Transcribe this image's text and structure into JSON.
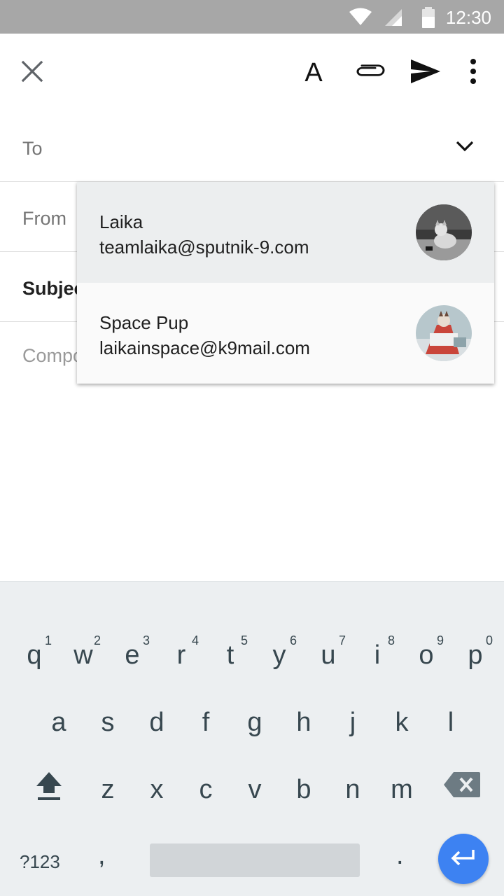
{
  "status_bar": {
    "time": "12:30",
    "icons": [
      "wifi-icon",
      "cellular-signal-icon",
      "battery-icon"
    ],
    "background_color": "#a7a7a7"
  },
  "toolbar": {
    "close_icon": "close-icon",
    "format_label": "A",
    "attach_icon": "paperclip-icon",
    "send_icon": "send-icon",
    "more_icon": "more-vert-icon"
  },
  "fields": {
    "to_label": "To",
    "from_label": "From",
    "subject_label": "Subjec",
    "compose_label": "Compo"
  },
  "suggestions": [
    {
      "name": "Laika",
      "email": "teamlaika@sputnik-9.com",
      "highlighted": true
    },
    {
      "name": "Space Pup",
      "email": "laikainspace@k9mail.com",
      "highlighted": false
    }
  ],
  "keyboard": {
    "row1": [
      {
        "ch": "q",
        "hint": "1"
      },
      {
        "ch": "w",
        "hint": "2"
      },
      {
        "ch": "e",
        "hint": "3"
      },
      {
        "ch": "r",
        "hint": "4"
      },
      {
        "ch": "t",
        "hint": "5"
      },
      {
        "ch": "y",
        "hint": "6"
      },
      {
        "ch": "u",
        "hint": "7"
      },
      {
        "ch": "i",
        "hint": "8"
      },
      {
        "ch": "o",
        "hint": "9"
      },
      {
        "ch": "p",
        "hint": "0"
      }
    ],
    "row2": [
      "a",
      "s",
      "d",
      "f",
      "g",
      "h",
      "j",
      "k",
      "l"
    ],
    "row3": [
      "z",
      "x",
      "c",
      "v",
      "b",
      "n",
      "m"
    ],
    "symbols_label": "?123",
    "comma_label": ",",
    "period_label": ".",
    "accent_color": "#3d82f2"
  }
}
